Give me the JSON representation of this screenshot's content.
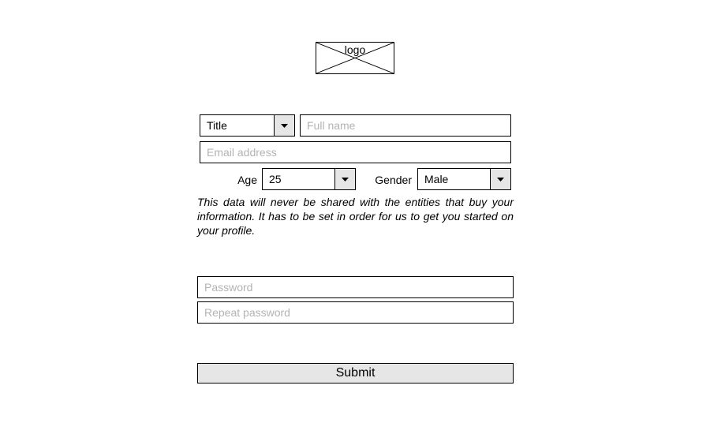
{
  "logo": {
    "text": "logo"
  },
  "personal": {
    "title_select": {
      "value": "Title"
    },
    "full_name": {
      "placeholder": "Full name",
      "value": ""
    },
    "email": {
      "placeholder": "Email address",
      "value": ""
    },
    "age": {
      "label": "Age",
      "value": "25"
    },
    "gender": {
      "label": "Gender",
      "value": "Male"
    },
    "note": "This data will never be shared with the entities that buy your information. It has to be set in order for us to get you started on your profile."
  },
  "security": {
    "password": {
      "placeholder": "Password",
      "value": ""
    },
    "repeat_password": {
      "placeholder": "Repeat password",
      "value": ""
    }
  },
  "actions": {
    "submit_label": "Submit"
  },
  "icons": {
    "dropdown": "caret-down-icon",
    "logo_placeholder": "image-placeholder-icon"
  },
  "colors": {
    "button_bg": "#e6e6e6",
    "placeholder": "#b3b3b3",
    "border": "#000000"
  }
}
